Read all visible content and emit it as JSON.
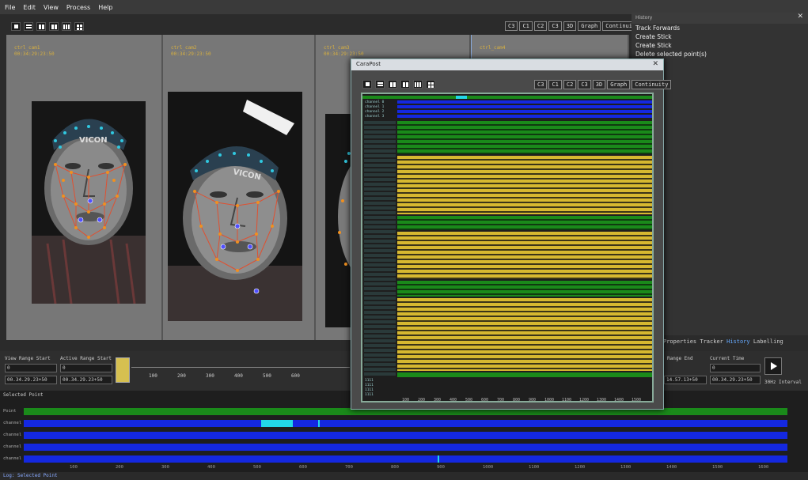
{
  "menu": [
    "File",
    "Edit",
    "View",
    "Process",
    "Help"
  ],
  "view_buttons": [
    "C3",
    "C1",
    "C2",
    "C3",
    "3D",
    "Graph",
    "Continuity"
  ],
  "panes": [
    {
      "title": "ctrl_cam1",
      "timecode": "00:34:29:23:50"
    },
    {
      "title": "ctrl_cam2",
      "timecode": "00:34:29:23:50"
    },
    {
      "title": "ctrl_cam3",
      "timecode": "00:34:29:23:50"
    },
    {
      "title": "ctrl_cam4",
      "timecode": ""
    }
  ],
  "face_labels": {
    "left": "VICON",
    "mid": "VICON"
  },
  "history": {
    "title": "History",
    "items": [
      "Track Forwards",
      "Create Stick",
      "Create Stick",
      "Delete selected point(s)"
    ]
  },
  "panel_tabs": [
    "Properties",
    "Tracker",
    "History",
    "Labelling"
  ],
  "timebar": {
    "view_range_start_label": "View Range Start",
    "view_range_start_value": "0",
    "view_range_start_tc": "00.34.29.23+50",
    "active_range_start_label": "Active Range Start",
    "active_range_start_value": "0",
    "active_range_start_tc": "00.34.29.23+50",
    "range_end_label": "Range End",
    "range_end_tc": "14.57.13+50",
    "current_time_label": "Current Time",
    "current_time_value": "0",
    "current_time_tc": "00.34.29.23+50",
    "interval": "30Hz Interval",
    "ticks": [
      "100",
      "200",
      "300",
      "400",
      "500",
      "600"
    ]
  },
  "selected_point": {
    "label": "Selected Point",
    "rows": [
      "Point",
      "channel 0",
      "channel 1",
      "channel 2",
      "channel 3",
      "channel 4"
    ],
    "ticks": [
      "100",
      "200",
      "300",
      "400",
      "500",
      "600",
      "700",
      "800",
      "900",
      "1000",
      "1100",
      "1200",
      "1300",
      "1400",
      "1500",
      "1600"
    ]
  },
  "floating_window": {
    "title": "CaraPost",
    "ticks": [
      "100",
      "200",
      "300",
      "400",
      "500",
      "600",
      "700",
      "800",
      "900",
      "1000",
      "1100",
      "1200",
      "1300",
      "1400",
      "1500",
      "1600"
    ],
    "top_rows": [
      "channel 0",
      "channel 1",
      "channel 2",
      "channel 3"
    ],
    "bottom_rows": [
      "1111",
      "1111",
      "1111",
      "1111"
    ]
  },
  "status": "Log: Selected Point",
  "colors": {
    "green": "#1a8a1a",
    "blue": "#1428e0",
    "yellow": "#d6b830",
    "cyan": "#22d8e8",
    "accent": "#d8b040"
  }
}
